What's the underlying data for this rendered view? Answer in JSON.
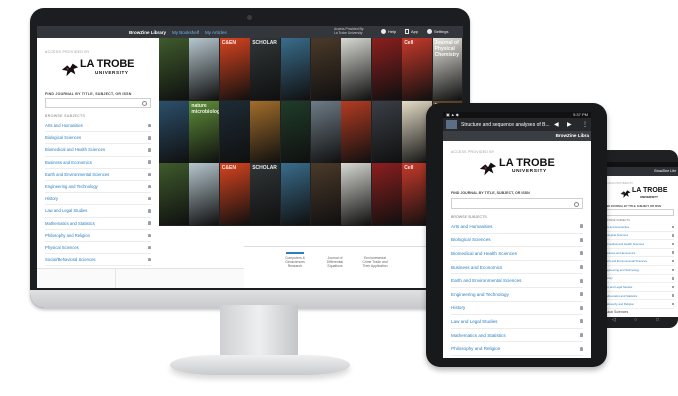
{
  "desktop": {
    "nav": {
      "brand": "BrowZine Library",
      "bookshelf": "My Bookshelf",
      "articles": "My Articles"
    },
    "access_text": "Access Provided By: La Trobe University",
    "tools": {
      "help": "Help",
      "app": "App",
      "settings": "Settings"
    },
    "accessed_label": "ACCESS PROVIDED BY",
    "logo": {
      "la_trobe": "LA TROBE",
      "university": "UNIVERSITY"
    },
    "find_label": "FIND JOURNAL BY TITLE, SUBJECT, OR ISSN",
    "search_value": "",
    "browse_label": "BROWSE SUBJECTS",
    "subjects": [
      "Arts and Humanities",
      "Biological Sciences",
      "Biomedical and Health Sciences",
      "Business and Economics",
      "Earth and Environmental Sciences",
      "Engineering and Technology",
      "History",
      "Law and Legal Studies",
      "Mathematics and Statistics",
      "Philosophy and Religion",
      "Physical Sciences",
      "Social/Behavioral Sciences"
    ],
    "covers": [
      {
        "label": "",
        "color": "#3f5b2c"
      },
      {
        "label": "",
        "color": "#b7c7cf"
      },
      {
        "label": "C&EN",
        "color": "#d8441f"
      },
      {
        "label": "SCHOLAR",
        "color": "#303638"
      },
      {
        "label": "",
        "color": "#3a6d8c"
      },
      {
        "label": "",
        "color": "#4b3a2a"
      },
      {
        "label": "",
        "color": "#d7d9d2"
      },
      {
        "label": "",
        "color": "#8c1f1f"
      },
      {
        "label": "Cell",
        "color": "#c73a2b"
      },
      {
        "label": "Journal of Physical Chemistry",
        "color": "#e7e6df"
      },
      {
        "label": "",
        "color": "#2c4f6b"
      },
      {
        "label": "nature microbiology",
        "color": "#5f8f3a"
      },
      {
        "label": "",
        "color": "#1e2b35"
      },
      {
        "label": "",
        "color": "#a26d2b"
      },
      {
        "label": "",
        "color": "#203c2a"
      },
      {
        "label": "",
        "color": "#6e7c86"
      },
      {
        "label": "",
        "color": "#b33c22"
      },
      {
        "label": "",
        "color": "#3a3f45"
      },
      {
        "label": "",
        "color": "#e5dcc6"
      },
      {
        "label": "Biological",
        "color": "#6b4a2a"
      }
    ],
    "captions": [
      "Computers & Geosciences Research",
      "Journal of Differential Equations",
      "Environmental Crime Trade and Their Application"
    ]
  },
  "tablet": {
    "status_right": "5:37 PM",
    "tab_title": "Structure and sequence analyses of B...",
    "sub_brand": "BrowZine Libra",
    "accessed_label": "ACCESS PROVIDED BY",
    "logo": {
      "la_trobe": "LA TROBE",
      "university": "UNIVERSITY"
    },
    "find_label": "FIND JOURNAL BY TITLE, SUBJECT, OR ISSN",
    "browse_label": "BROWSE SUBJECTS",
    "subjects": [
      "Arts and Humanities",
      "Biological Sciences",
      "Biomedical and Health Sciences",
      "Business and Economics",
      "Earth and Environmental Sciences",
      "Engineering and Technology",
      "History",
      "Law and Legal Studies",
      "Mathematics and Statistics",
      "Philosophy and Religion"
    ]
  },
  "phone": {
    "bar_text": "BrowZine Libr",
    "accessed_label": "ACCESS PROVIDED BY",
    "logo": {
      "la_trobe": "LA TROBE",
      "university": "UNIVERSITY"
    },
    "find_label": "FIND JOURNAL BY TITLE, SUBJECT, OR ISSN",
    "browse_label": "BROWSE SUBJECTS",
    "subjects": [
      "Arts and Humanities",
      "Biological Sciences",
      "Biomedical and Health Sciences",
      "Business and Economics",
      "Earth and Environmental Sciences",
      "Engineering and Technology",
      "History",
      "Law and Legal Studies",
      "Mathematics and Statistics",
      "Philosophy and Religion"
    ],
    "footer_subject": "Physical Sciences"
  },
  "colors": {
    "link": "#2a7fc1",
    "topbar": "#33373c"
  }
}
